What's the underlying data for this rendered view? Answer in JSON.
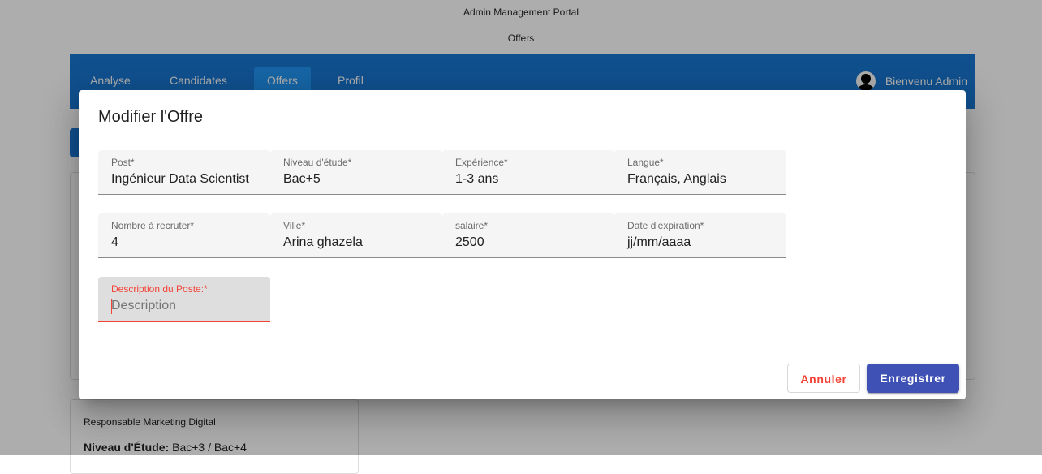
{
  "app": {
    "title": "Admin Management Portal",
    "page": "Offers"
  },
  "nav": {
    "tabs": [
      {
        "label": "Analyse",
        "active": false
      },
      {
        "label": "Candidates",
        "active": false
      },
      {
        "label": "Offers",
        "active": true
      },
      {
        "label": "Profil",
        "active": false
      }
    ],
    "user_greeting": "Bienvenu Admin"
  },
  "background_card": {
    "title": "Responsable Marketing Digital",
    "education_label": "Niveau d'Étude:",
    "education_value": "Bac+3 / Bac+4"
  },
  "dialog": {
    "title": "Modifier l'Offre",
    "fields": {
      "post": {
        "label": "Post*",
        "value": "Ingénieur Data Scientist"
      },
      "niveau": {
        "label": "Niveau d'étude*",
        "value": "Bac+5"
      },
      "experience": {
        "label": "Expérience*",
        "value": "1-3 ans"
      },
      "langue": {
        "label": "Langue*",
        "value": "Français, Anglais"
      },
      "nombre": {
        "label": "Nombre à recruter*",
        "value": "4"
      },
      "ville": {
        "label": "Ville*",
        "value": "Arina ghazela"
      },
      "salaire": {
        "label": "salaire*",
        "value": "2500"
      },
      "date": {
        "label": "Date d'expiration*",
        "value": "jj/mm/aaaa"
      },
      "description": {
        "label": "Description du Poste:*",
        "value": "",
        "placeholder": "Description"
      }
    },
    "buttons": {
      "cancel": "Annuler",
      "save": "Enregistrer"
    }
  },
  "colors": {
    "primary": "#1976d2",
    "active_tab": "#2196f3",
    "save_button": "#3f51b5",
    "error_accent": "#f44336"
  }
}
